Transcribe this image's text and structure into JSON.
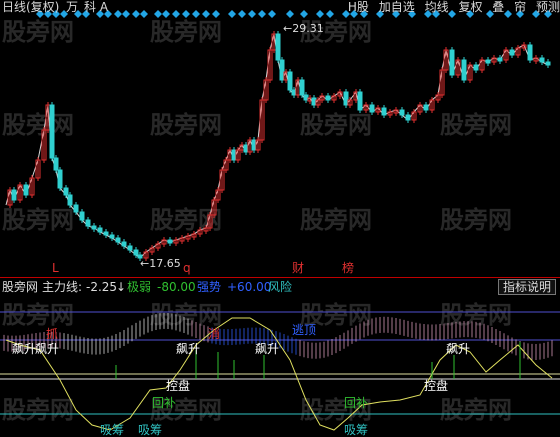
{
  "header": {
    "chart_mode": "日线(复权)",
    "unit": "万",
    "letters": "科 A",
    "toolbar": [
      "H股",
      "加自选",
      "均线",
      "复权",
      "叠",
      "帘",
      "预测"
    ]
  },
  "price_labels": {
    "high": "29.31",
    "low": "17.65"
  },
  "event_markers": {
    "l": "L",
    "q": "q",
    "cai": "财",
    "bang": "榜"
  },
  "indicator": {
    "name": "股旁网",
    "line_label": "主力线:",
    "line_value": "-2.25",
    "weak_label": "极弱",
    "weak_value": "-80.00",
    "strong_label": "强势",
    "strong_value": "+60.00",
    "risk_label": "风险",
    "help_button": "指标说明"
  },
  "annotations": {
    "grab": "抓",
    "grab_rise": "飙升",
    "grab_rise2": "飙升",
    "grab_rise3": "飙升",
    "grab_rise4": "飙升",
    "escape": "逃顶",
    "control": "控盘",
    "control2": "控盘",
    "pullback": "回补",
    "pullback2": "回补",
    "absorb": "吸筹",
    "absorb2": "吸筹",
    "absorb3": "吸筹",
    "xiao": "消"
  },
  "watermark": "股旁网",
  "colors": {
    "bg": "#000000",
    "up": "#e03030",
    "down": "#30d0d0",
    "ma": "#d8d8d8",
    "diamond": "#22a6e6",
    "weak": "#30c030",
    "strong": "#3060ff",
    "risk": "#30c0c0"
  }
}
